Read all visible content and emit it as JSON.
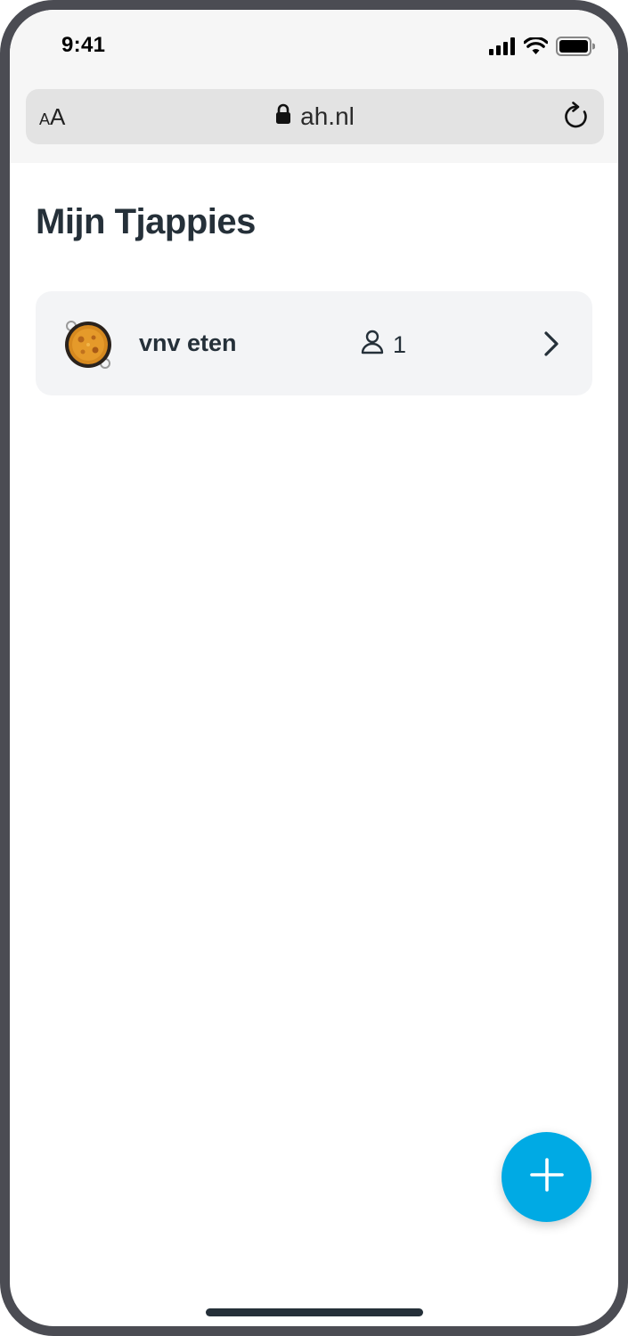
{
  "status_bar": {
    "time": "9:41"
  },
  "browser": {
    "text_size_label": "AA",
    "url": "ah.nl"
  },
  "page": {
    "title": "Mijn Tjappies"
  },
  "lists": [
    {
      "name": "vnv eten",
      "member_count": "1"
    }
  ],
  "icons": {
    "lock": "lock-icon",
    "reload": "reload-icon",
    "person": "person-icon",
    "chevron": "chevron-right-icon",
    "add": "plus-icon"
  },
  "colors": {
    "accent": "#00aae4",
    "text": "#253039",
    "card": "#f3f4f6",
    "frame": "#4b4c53"
  }
}
